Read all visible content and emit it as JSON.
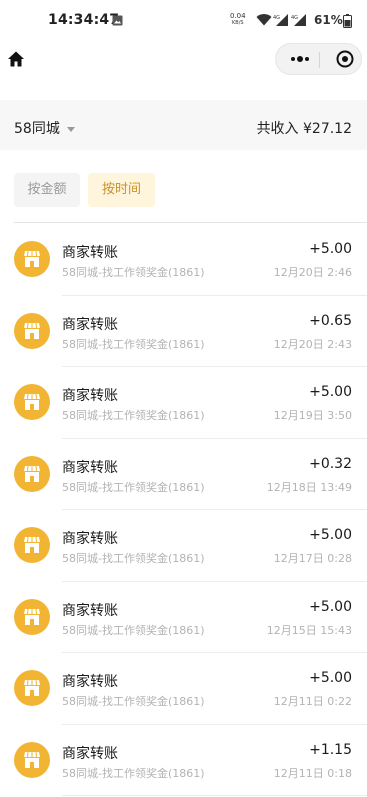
{
  "status_bar": {
    "time": "14:34:47",
    "net_speed": "0.04",
    "net_speed_unit": "KB/S",
    "signal1_label": "4G",
    "signal2_label": "4G",
    "battery_percent": "61%"
  },
  "header": {
    "city": "58同城",
    "total_income": "共收入 ¥27.12"
  },
  "sort_tabs": [
    {
      "label": "按金额",
      "active": false
    },
    {
      "label": "按时间",
      "active": true
    }
  ],
  "transactions": [
    {
      "title": "商家转账",
      "subtitle": "58同城-找工作领奖金(1861)",
      "amount": "+5.00",
      "time": "12月20日 2:46"
    },
    {
      "title": "商家转账",
      "subtitle": "58同城-找工作领奖金(1861)",
      "amount": "+0.65",
      "time": "12月20日 2:43"
    },
    {
      "title": "商家转账",
      "subtitle": "58同城-找工作领奖金(1861)",
      "amount": "+5.00",
      "time": "12月19日 3:50"
    },
    {
      "title": "商家转账",
      "subtitle": "58同城-找工作领奖金(1861)",
      "amount": "+0.32",
      "time": "12月18日 13:49"
    },
    {
      "title": "商家转账",
      "subtitle": "58同城-找工作领奖金(1861)",
      "amount": "+5.00",
      "time": "12月17日 0:28"
    },
    {
      "title": "商家转账",
      "subtitle": "58同城-找工作领奖金(1861)",
      "amount": "+5.00",
      "time": "12月15日 15:43"
    },
    {
      "title": "商家转账",
      "subtitle": "58同城-找工作领奖金(1861)",
      "amount": "+5.00",
      "time": "12月11日 0:22"
    },
    {
      "title": "商家转账",
      "subtitle": "58同城-找工作领奖金(1861)",
      "amount": "+1.15",
      "time": "12月11日 0:18"
    }
  ],
  "colors": {
    "accent": "#f2b533",
    "active_tab_bg": "#fff4dc",
    "active_tab_text": "#c8932a"
  },
  "icons": {
    "home": "home-icon",
    "more": "more-dots-icon",
    "close": "target-close-icon",
    "merchant": "storefront-icon"
  }
}
